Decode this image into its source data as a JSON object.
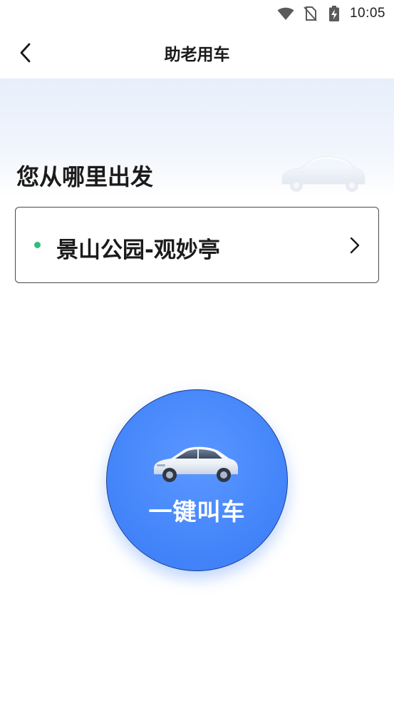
{
  "status_bar": {
    "time": "10:05",
    "icons": [
      "wifi-icon",
      "no-sim-icon",
      "battery-charging-icon"
    ]
  },
  "nav": {
    "title": "助老用车",
    "back_icon": "chevron-left-icon"
  },
  "hero": {
    "heading": "您从哪里出发",
    "decoration_icon": "car-icon"
  },
  "location": {
    "name": "景山公园-观妙亭",
    "dot_color": "#2dbf7a",
    "arrow_icon": "chevron-right-icon"
  },
  "call_button": {
    "label": "一键叫车",
    "icon": "car-icon",
    "color": "#4687fb"
  }
}
